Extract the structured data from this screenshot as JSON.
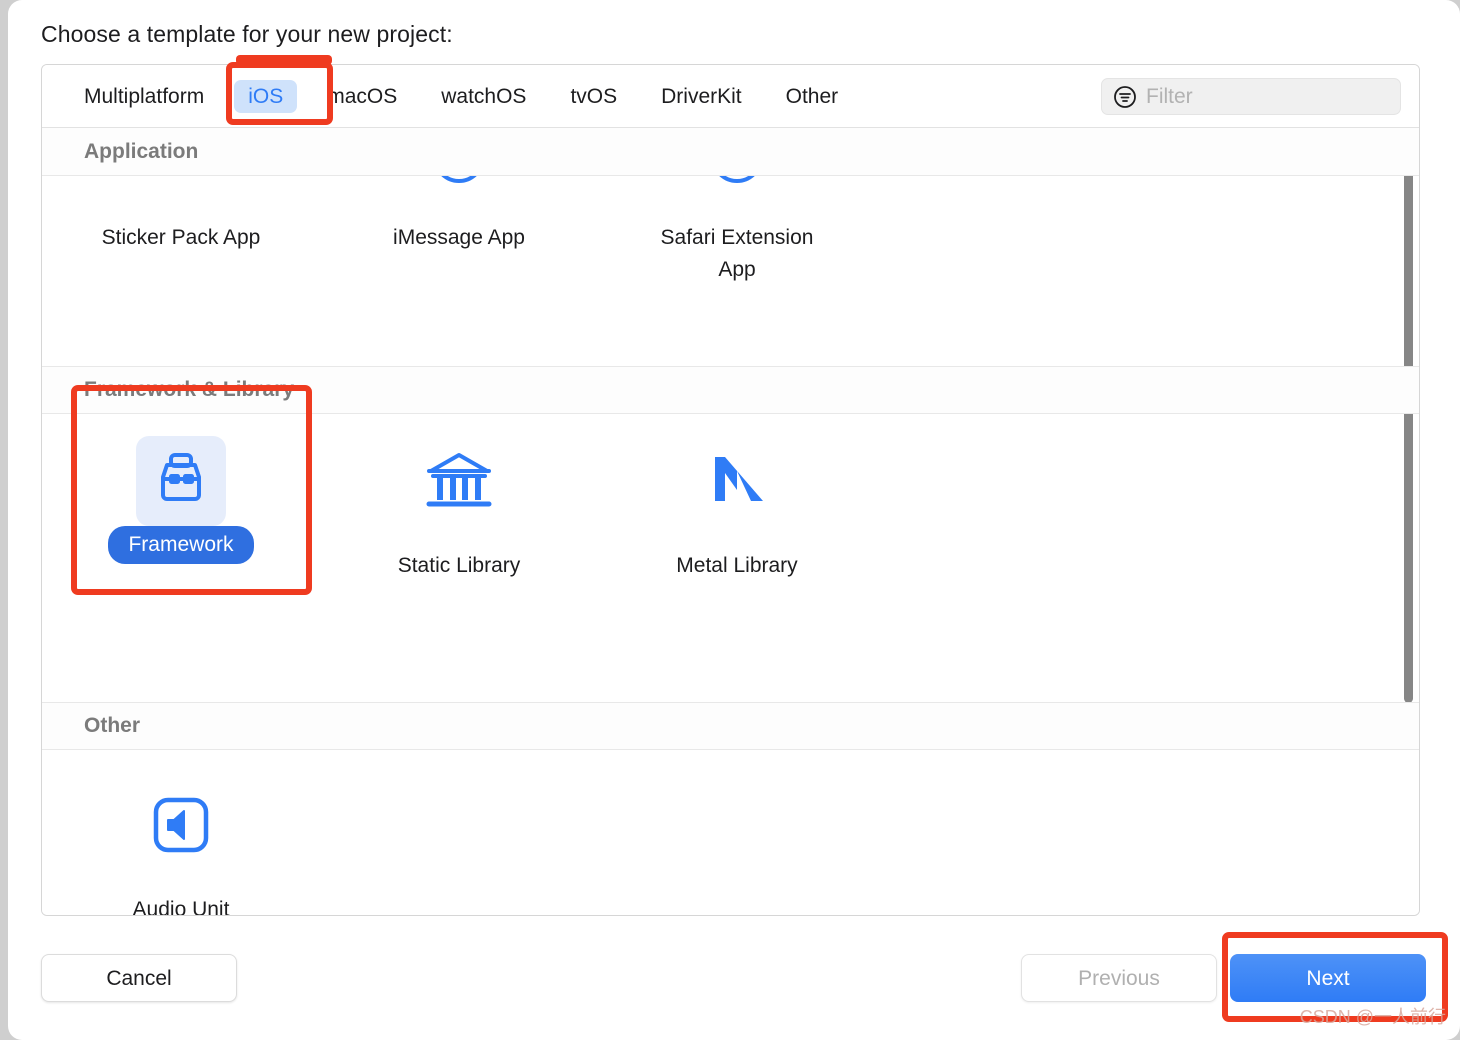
{
  "dialog": {
    "title": "Choose a template for your new project:"
  },
  "tabs": [
    {
      "label": "Multiplatform",
      "active": false
    },
    {
      "label": "iOS",
      "active": true
    },
    {
      "label": "macOS",
      "active": false
    },
    {
      "label": "watchOS",
      "active": false
    },
    {
      "label": "tvOS",
      "active": false
    },
    {
      "label": "DriverKit",
      "active": false
    },
    {
      "label": "Other",
      "active": false
    }
  ],
  "filter": {
    "placeholder": "Filter",
    "value": "",
    "icon": "filter-icon"
  },
  "sections": [
    {
      "header": "Application",
      "items": [
        {
          "label": "Sticker Pack App",
          "icon": "sticker-pack-icon",
          "selected": false
        },
        {
          "label": "iMessage App",
          "icon": "imessage-icon",
          "selected": false
        },
        {
          "label": "Safari Extension\nApp",
          "icon": "safari-extension-icon",
          "selected": false
        }
      ]
    },
    {
      "header": "Framework & Library",
      "items": [
        {
          "label": "Framework",
          "icon": "toolbox-icon",
          "selected": true
        },
        {
          "label": "Static Library",
          "icon": "library-building-icon",
          "selected": false
        },
        {
          "label": "Metal Library",
          "icon": "metal-m-icon",
          "selected": false
        }
      ]
    },
    {
      "header": "Other",
      "items": [
        {
          "label": "Audio Unit\nExtension App",
          "icon": "speaker-icon",
          "selected": false
        }
      ]
    }
  ],
  "buttons": {
    "cancel": "Cancel",
    "previous": "Previous",
    "next": "Next"
  },
  "watermark": "CSDN @一人前行",
  "colors": {
    "accent_blue": "#2f7cf6",
    "selected_pill": "#2f6fe0",
    "selected_bg": "#e6edfb",
    "tab_active_bg": "#cfe2fb",
    "annotation_red": "#ef3b20",
    "section_header_text": "#7b7b7b"
  }
}
